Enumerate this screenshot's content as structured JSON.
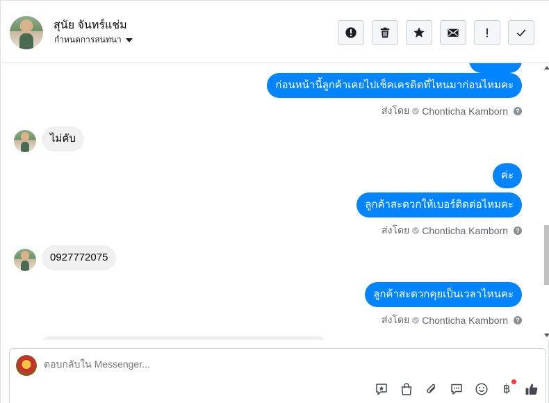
{
  "header": {
    "contact_name": "สุนัย จันทร์แช่ม",
    "assign_label": "กำหนดการสนทนา",
    "actions": [
      {
        "name": "spam",
        "icon": "exclamation-circle-icon"
      },
      {
        "name": "delete",
        "icon": "trash-icon"
      },
      {
        "name": "star",
        "icon": "star-icon"
      },
      {
        "name": "mark-unread",
        "icon": "envelope-icon"
      },
      {
        "name": "follow-up",
        "icon": "exclamation-icon"
      },
      {
        "name": "done",
        "icon": "checkmark-icon"
      }
    ]
  },
  "messages": [
    {
      "direction": "out",
      "text": "ก่อนหน้านี้ลูกค้าเคยไปเช็คเครดิตที่ไหนมาก่อนไหมคะ"
    },
    {
      "direction": "meta",
      "sent_by_label": "ส่งโดย",
      "agent": "Chonticha Kamborn"
    },
    {
      "direction": "in",
      "text": "ไม่คับ"
    },
    {
      "direction": "out",
      "text": "ค่ะ"
    },
    {
      "direction": "out",
      "text": "ลูกค้าสะดวกให้เบอร์ติดต่อไหมคะ"
    },
    {
      "direction": "meta",
      "sent_by_label": "ส่งโดย",
      "agent": "Chonticha Kamborn"
    },
    {
      "direction": "in",
      "text": "0927772075"
    },
    {
      "direction": "out",
      "text": "ลูกค้าสะดวกคุยเป็นเวลาไหนคะ"
    },
    {
      "direction": "meta",
      "sent_by_label": "ส่งโดย",
      "agent": "Chonticha Kamborn"
    }
  ],
  "composer": {
    "placeholder": "ตอบกลับใน Messenger...",
    "tools": [
      "saved-reply-icon",
      "shop-bag-icon",
      "attachment-icon",
      "chat-bubble-icon",
      "emoji-icon",
      "baht-icon",
      "like-icon"
    ],
    "baht_symbol": "฿"
  },
  "colors": {
    "outgoing_bubble": "#0084ff",
    "incoming_bubble": "#f0f0f0",
    "notification_dot": "#fa383e"
  }
}
